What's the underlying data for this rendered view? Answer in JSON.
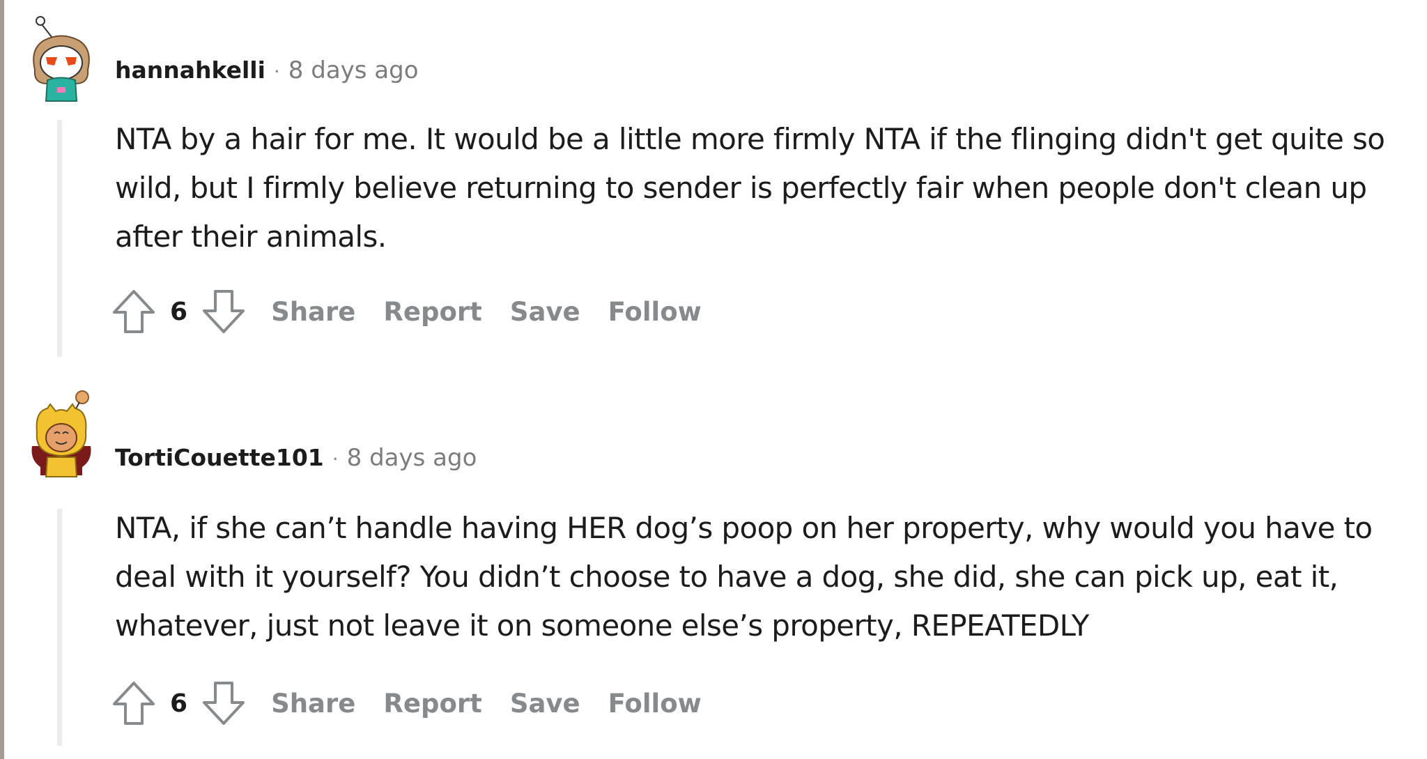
{
  "comments": [
    {
      "username": "hannahkelli",
      "separator": "·",
      "time": "8 days ago",
      "body": "NTA by a hair for me. It would be a little more firmly NTA if the flinging didn't get quite so wild, but I firmly believe returning to sender is perfectly fair when people don't clean up after their animals.",
      "votes": "6",
      "actions": {
        "share": "Share",
        "report": "Report",
        "save": "Save",
        "follow": "Follow"
      },
      "avatar_icon": "snoo-avatar-hannahkelli"
    },
    {
      "username": "TortiCouette101",
      "separator": "·",
      "time": "8 days ago",
      "body": "NTA, if she can’t handle having HER dog’s poop on her property, why would you have to deal with it yourself? You didn’t choose to have a dog, she did, she can pick up, eat it, whatever, just not leave it on someone else’s property, REPEATEDLY",
      "votes": "6",
      "actions": {
        "share": "Share",
        "report": "Report",
        "save": "Save",
        "follow": "Follow"
      },
      "avatar_icon": "snoo-avatar-torticouette"
    }
  ],
  "colors": {
    "text": "#1c1c1c",
    "meta": "#7c7c7c",
    "action": "#878a8c",
    "thread_line": "#ececec"
  }
}
